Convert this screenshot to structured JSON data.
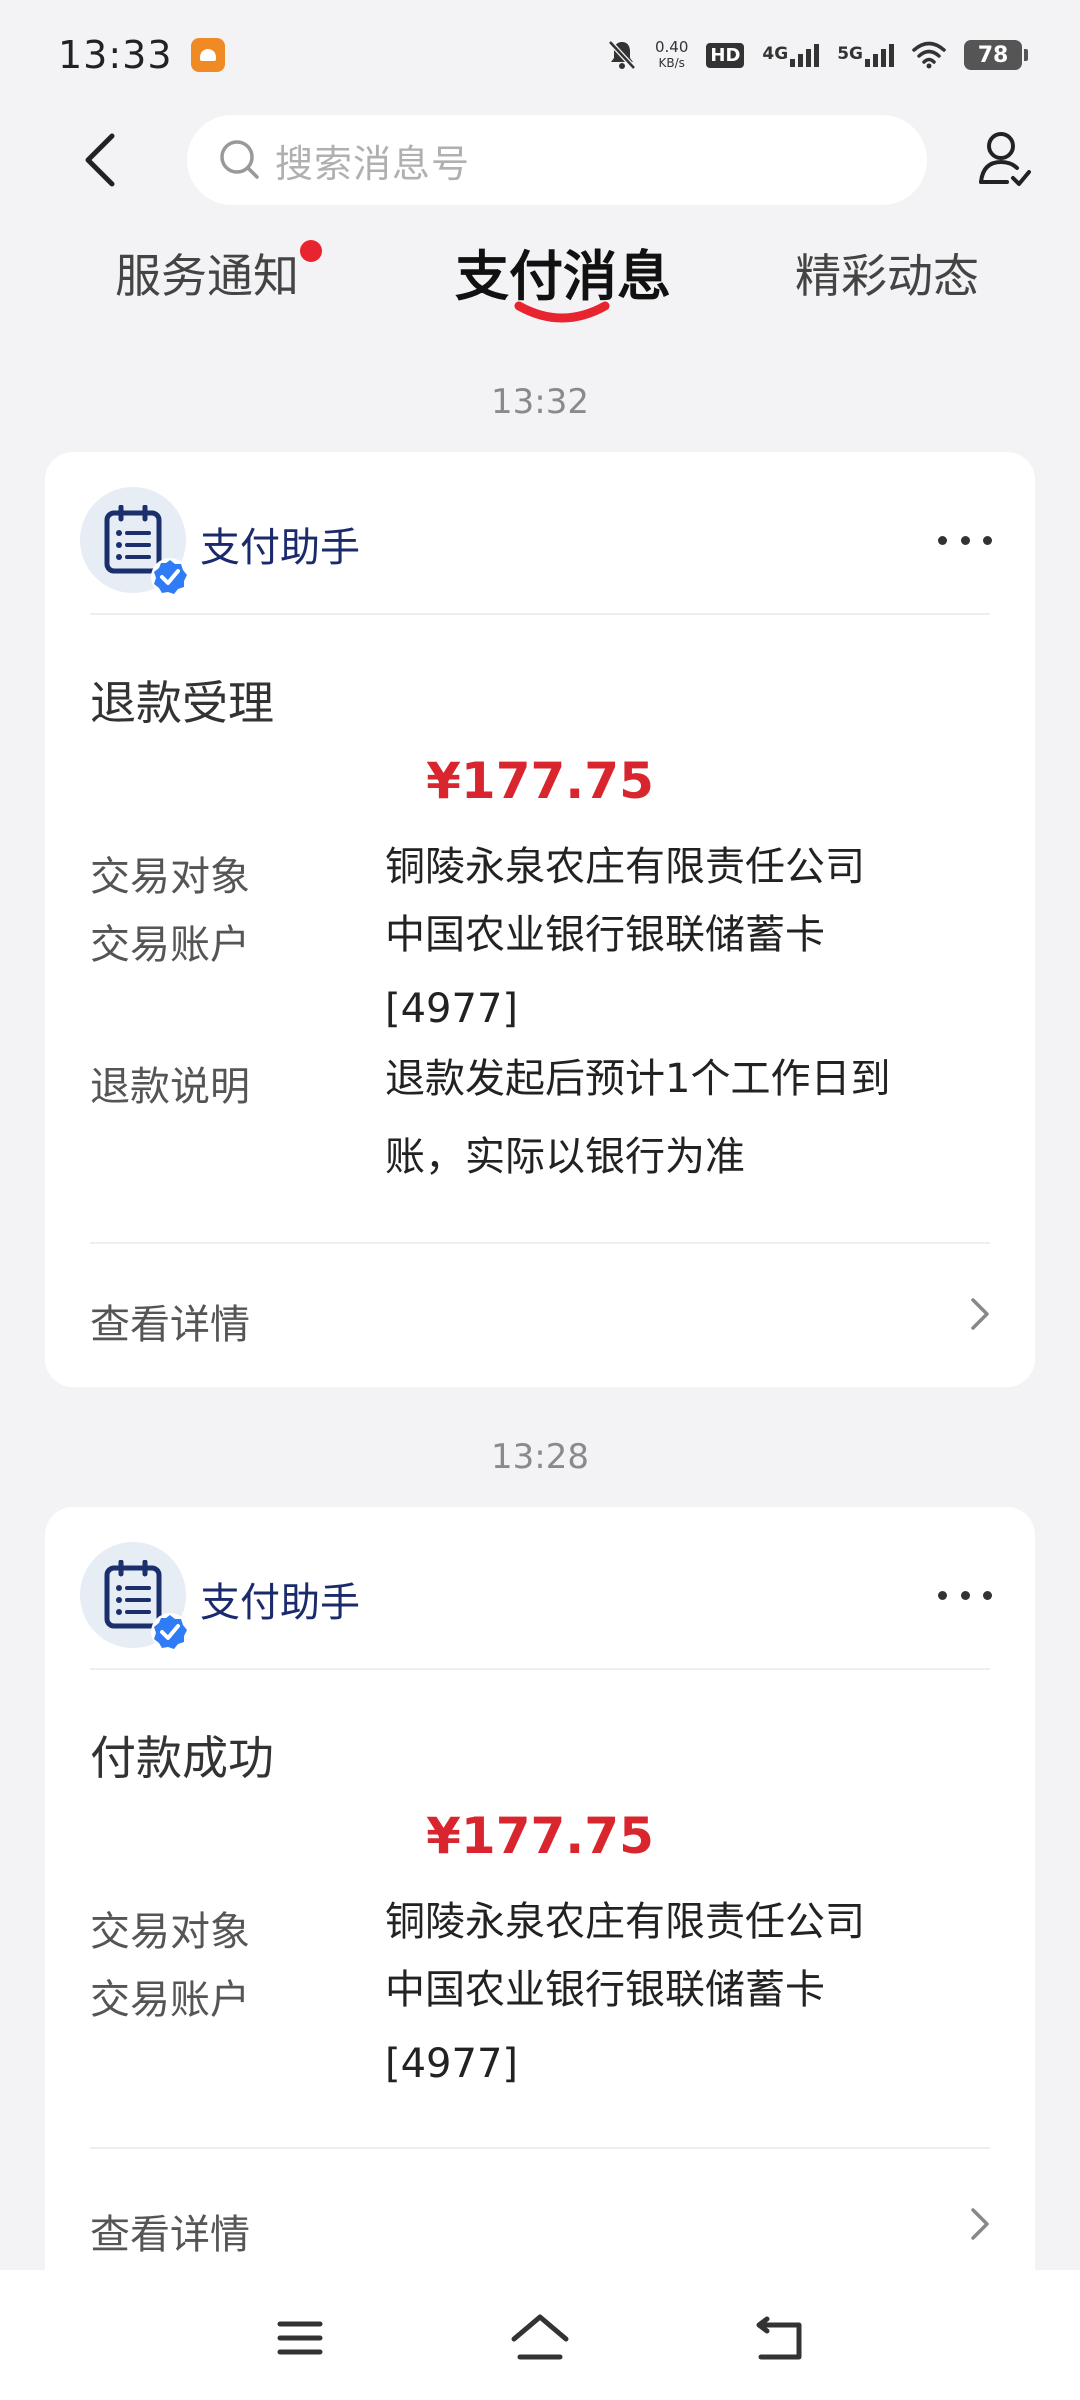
{
  "status_bar": {
    "time": "13:33",
    "net_speed_value": "0.40",
    "net_speed_unit": "KB/s",
    "hd": "HD",
    "sim1": "4G",
    "sim2": "5G",
    "battery": "78"
  },
  "header": {
    "search_placeholder": "搜索消息号"
  },
  "tabs": [
    {
      "label": "服务通知",
      "has_dot": true
    },
    {
      "label": "支付消息",
      "active": true
    },
    {
      "label": "精彩动态"
    }
  ],
  "messages": [
    {
      "time": "13:32",
      "sender": "支付助手",
      "title": "退款受理",
      "amount": "¥177.75",
      "rows": [
        {
          "label": "交易对象",
          "value": "铜陵永泉农庄有限责任公司"
        },
        {
          "label": "交易账户",
          "value": "中国农业银行银联储蓄卡\n[4977]"
        },
        {
          "label": "退款说明",
          "value": "退款发起后预计1个工作日到\n账，实际以银行为准"
        }
      ],
      "link": "查看详情"
    },
    {
      "time": "13:28",
      "sender": "支付助手",
      "title": "付款成功",
      "amount": "¥177.75",
      "rows": [
        {
          "label": "交易对象",
          "value": "铜陵永泉农庄有限责任公司"
        },
        {
          "label": "交易账户",
          "value": "中国农业银行银联储蓄卡\n[4977]"
        }
      ],
      "link": "查看详情"
    }
  ],
  "colors": {
    "accent_red": "#d9252e",
    "sender_blue": "#1a2a6c",
    "background": "#f3f3f5"
  },
  "icons": [
    "back-arrow-icon",
    "search-icon",
    "user-check-icon",
    "clipboard-icon",
    "verified-badge-icon",
    "more-icon",
    "chevron-right-icon",
    "menu-icon",
    "home-icon",
    "return-icon"
  ]
}
